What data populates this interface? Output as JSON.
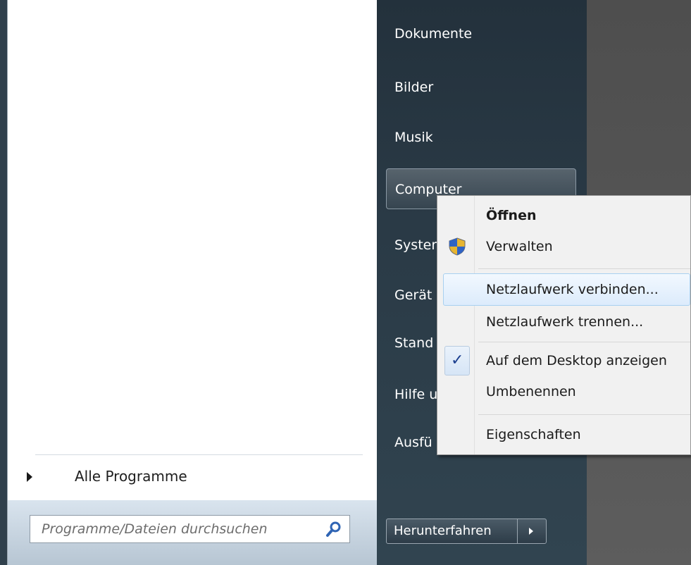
{
  "right_items": [
    {
      "label": "Dokumente"
    },
    {
      "label": "Bilder"
    },
    {
      "label": "Musik"
    },
    {
      "label": "Computer"
    },
    {
      "label": "Syster"
    },
    {
      "label": "Gerät"
    },
    {
      "label": "Stand"
    },
    {
      "label": "Hilfe u"
    },
    {
      "label": "Ausfü"
    }
  ],
  "all_programs": {
    "label": "Alle Programme"
  },
  "search": {
    "placeholder": "Programme/Dateien durchsuchen"
  },
  "shutdown": {
    "label": "Herunterfahren"
  },
  "context_menu": {
    "items": [
      {
        "label": "Öffnen",
        "bold": true
      },
      {
        "label": "Verwalten",
        "icon": "uac-shield-icon"
      },
      {
        "label": "Netzlaufwerk verbinden...",
        "highlighted": true
      },
      {
        "label": "Netzlaufwerk trennen..."
      },
      {
        "label": "Auf dem Desktop anzeigen",
        "checked": true
      },
      {
        "label": "Umbenennen"
      },
      {
        "label": "Eigenschaften"
      }
    ]
  },
  "colors": {
    "right_pane": "#2a3a46",
    "menu_bg": "#f1f1f1",
    "highlight_border": "#a8d0f0",
    "check": "#1c3f8f"
  }
}
